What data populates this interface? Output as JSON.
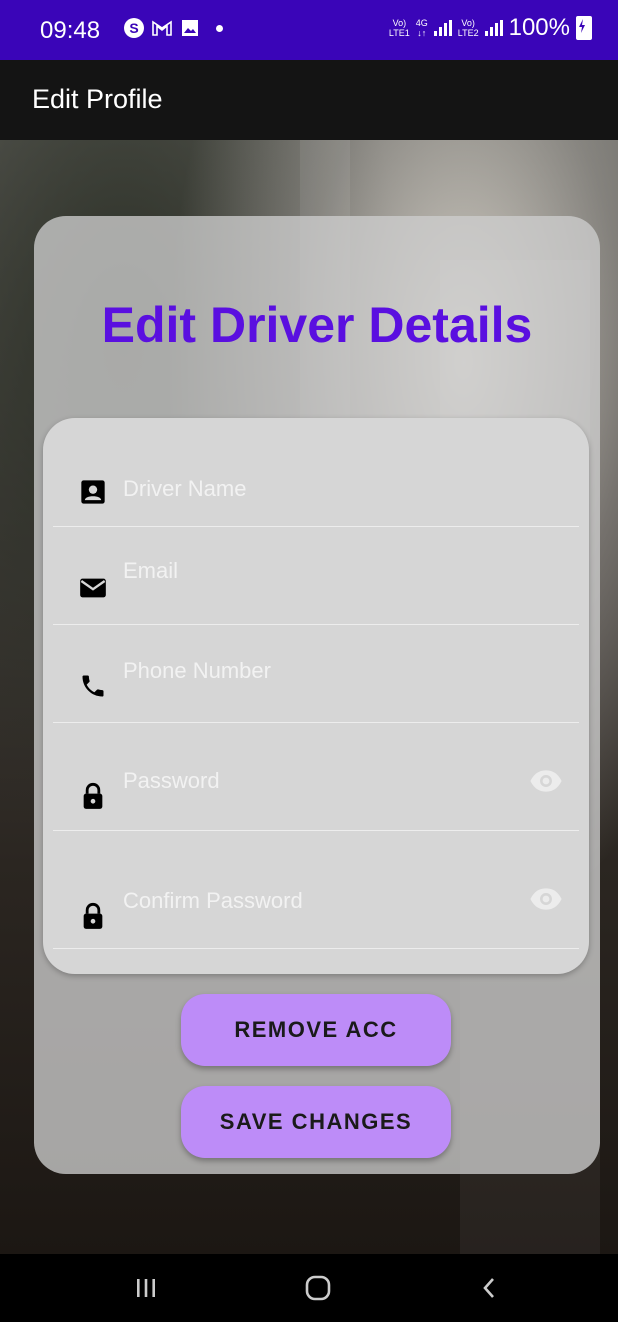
{
  "status_bar": {
    "time": "09:48",
    "left_icons": [
      "s-icon",
      "gmail-icon",
      "gallery-icon",
      "dot-icon"
    ],
    "network": [
      {
        "top": "Vo)",
        "bottom": "LTE1"
      },
      {
        "top": "4G",
        "bottom": "↓↑"
      },
      {
        "top": "Vo)",
        "bottom": "LTE2"
      }
    ],
    "battery_text": "100%",
    "color": "#3a05b8"
  },
  "app_bar": {
    "title": "Edit Profile"
  },
  "card": {
    "heading": "Edit Driver Details",
    "heading_color": "#5a0fe0"
  },
  "form": {
    "fields": [
      {
        "placeholder": "Driver Name",
        "icon": "person-icon"
      },
      {
        "placeholder": "Email",
        "icon": "mail-icon"
      },
      {
        "placeholder": "Phone Number",
        "icon": "phone-icon"
      },
      {
        "placeholder": "Password",
        "icon": "lock-icon",
        "toggle": "eye-icon"
      },
      {
        "placeholder": "Confirm Password",
        "icon": "lock-icon",
        "toggle": "eye-icon"
      }
    ]
  },
  "buttons": {
    "remove_label": "REMOVE ACC",
    "save_label": "SAVE CHANGES",
    "color": "#bd8cf8"
  },
  "nav_bar": {
    "items": [
      "recents-icon",
      "home-icon",
      "back-icon"
    ]
  }
}
